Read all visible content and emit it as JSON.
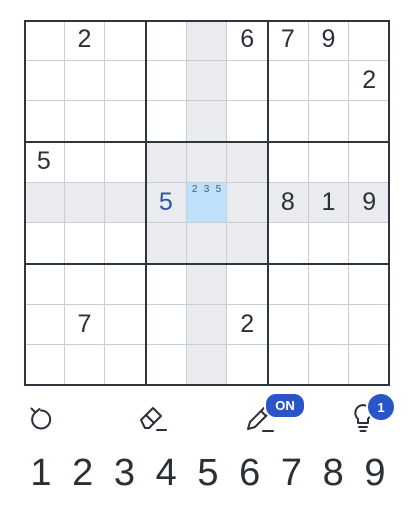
{
  "colors": {
    "given": "#2b2f38",
    "user": "#2f55a5",
    "highlight": "#e9ebee",
    "selected": "#bfe0fb",
    "badge": "#2a55c9"
  },
  "board": {
    "selected": [
      4,
      4
    ],
    "givens": [
      [
        "",
        "2",
        "",
        "",
        "",
        "6",
        "7",
        "9",
        ""
      ],
      [
        "",
        "",
        "",
        "",
        "",
        "",
        "",
        "",
        "2"
      ],
      [
        "",
        "",
        "",
        "",
        "",
        "",
        "",
        "",
        ""
      ],
      [
        "5",
        "",
        "",
        "",
        "",
        "",
        "",
        "",
        ""
      ],
      [
        "",
        "",
        "",
        "",
        "",
        "",
        "8",
        "1",
        "9"
      ],
      [
        "",
        "",
        "",
        "",
        "",
        "",
        "",
        "",
        ""
      ],
      [
        "",
        "",
        "",
        "",
        "",
        "",
        "",
        "",
        ""
      ],
      [
        "",
        "7",
        "",
        "",
        "",
        "2",
        "",
        "",
        ""
      ],
      [
        "",
        "",
        "",
        "",
        "",
        "",
        "",
        "",
        ""
      ]
    ],
    "user_entries": [
      {
        "row": 4,
        "col": 3,
        "value": "5"
      }
    ],
    "notes": [
      {
        "row": 4,
        "col": 4,
        "values": [
          "2",
          "3",
          "5"
        ]
      }
    ]
  },
  "toolbar": {
    "undo_icon": "undo-icon",
    "erase_icon": "eraser-icon",
    "notes_icon": "pencil-icon",
    "notes_badge": "ON",
    "hint_icon": "lightbulb-icon",
    "hint_badge": "1"
  },
  "numpad": [
    "1",
    "2",
    "3",
    "4",
    "5",
    "6",
    "7",
    "8",
    "9"
  ]
}
